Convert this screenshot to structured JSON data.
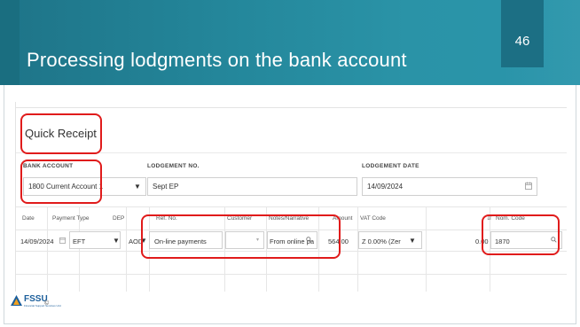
{
  "slide": {
    "title": "Processing lodgments on the bank account",
    "number": "46"
  },
  "form": {
    "title": "Quick Receipt",
    "bank_account_label": "BANK ACCOUNT",
    "bank_account_value": "1800 Current Account 1",
    "lodgement_no_label": "LODGEMENT NO.",
    "lodgement_no_value": "Sept EP",
    "lodgement_date_label": "LODGEMENT DATE",
    "lodgement_date_value": "14/09/2024"
  },
  "table": {
    "columns": [
      "Date",
      "Payment Type",
      "DEP",
      "Ref. No.",
      "Customer",
      "Notes/Narrative",
      "Amount",
      "VAT Code",
      "Nom. Code"
    ],
    "row": {
      "date": "14/09/2024",
      "payment_type": "EFT",
      "dep": "AOD",
      "ref_no": "On-line payments",
      "customer": "",
      "notes": "From online pa",
      "amount": "564.00",
      "vat_code": "Z 0.00% (Zer",
      "vat_amount": "0.00",
      "nom_code": "1870"
    }
  },
  "logo": {
    "name": "FSSU",
    "subtitle": "Financial Support Services Unit",
    "copyright": "©"
  },
  "colors": {
    "header": "#24879b",
    "highlight": "#e01b1b",
    "brand": "#1b5e9b"
  }
}
